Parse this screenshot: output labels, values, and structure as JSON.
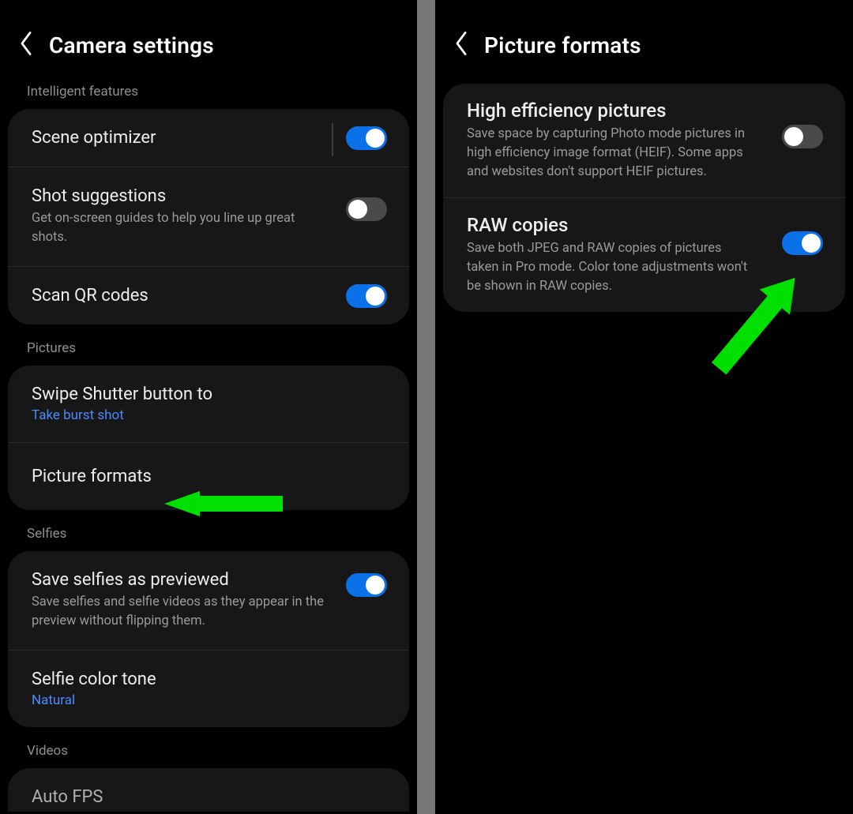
{
  "left": {
    "title": "Camera settings",
    "sections": {
      "intelligent": {
        "header": "Intelligent features",
        "scene_optimizer": {
          "label": "Scene optimizer",
          "on": true
        },
        "shot_suggestions": {
          "label": "Shot suggestions",
          "sub": "Get on-screen guides to help you line up great shots.",
          "on": false
        },
        "scan_qr": {
          "label": "Scan QR codes",
          "on": true
        }
      },
      "pictures": {
        "header": "Pictures",
        "swipe_shutter": {
          "label": "Swipe Shutter button to",
          "value": "Take burst shot"
        },
        "picture_formats": {
          "label": "Picture formats"
        }
      },
      "selfies": {
        "header": "Selfies",
        "save_selfies": {
          "label": "Save selfies as previewed",
          "sub": "Save selfies and selfie videos as they appear in the preview without flipping them.",
          "on": true
        },
        "selfie_tone": {
          "label": "Selfie color tone",
          "value": "Natural"
        }
      },
      "videos": {
        "header": "Videos",
        "auto_fps": {
          "label": "Auto FPS"
        }
      }
    }
  },
  "right": {
    "title": "Picture formats",
    "heif": {
      "label": "High efficiency pictures",
      "sub": "Save space by capturing Photo mode pictures in high efficiency image format (HEIF). Some apps and websites don't support HEIF pictures.",
      "on": false
    },
    "raw": {
      "label": "RAW copies",
      "sub": "Save both JPEG and RAW copies of pictures taken in Pro mode. Color tone adjustments won't be shown in RAW copies.",
      "on": true
    }
  },
  "annotations": {
    "arrow_color": "#00e000"
  }
}
